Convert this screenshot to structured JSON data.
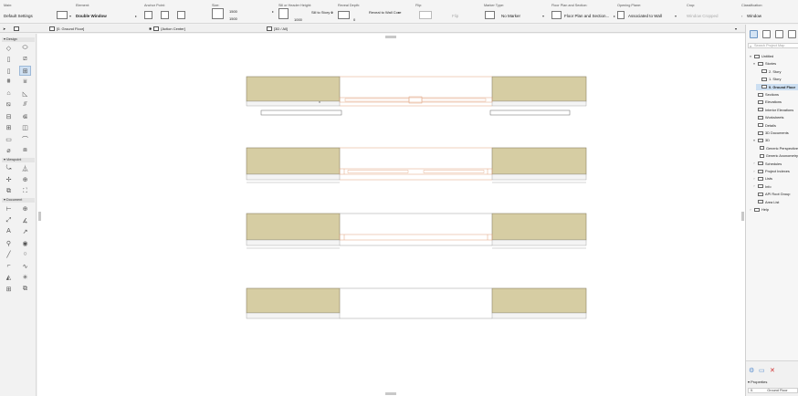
{
  "infobar": {
    "main": {
      "title": "Main:",
      "value": "Default Settings"
    },
    "element": {
      "title": "Element:",
      "value": "Double Window"
    },
    "anchor": {
      "title": "Anchor Point:"
    },
    "size": {
      "title": "Size:",
      "width": "1500",
      "height": "1500"
    },
    "sill": {
      "title": "Sill or Header Height:",
      "value": "1000",
      "mode": "Sill to Story 0"
    },
    "reveal": {
      "title": "Reveal Depth:",
      "value": "0",
      "mode": "Reveal to Wall Core"
    },
    "flip": {
      "title": "Flip:",
      "value": "Flip"
    },
    "marker": {
      "title": "Marker Type:",
      "value": "No Marker"
    },
    "floorplan": {
      "title": "Floor Plan and Section:",
      "value": "Floor Plan and Section..."
    },
    "opening": {
      "title": "Opening Plane:",
      "value": "Associated to Wall"
    },
    "crop": {
      "title": "Crop:",
      "value": "Window Cropped"
    },
    "classification": {
      "title": "Classification:",
      "value": "Window"
    }
  },
  "tabs": [
    {
      "label": "[0. Ground Floor]"
    },
    {
      "label": "[Action Center]"
    },
    {
      "label": "[3D / All]"
    }
  ],
  "toolbox": {
    "sections": [
      "Design",
      "Viewpoint",
      "Document"
    ]
  },
  "navigator": {
    "search_placeholder": "Search Project Map",
    "tree": [
      {
        "label": "Untitled",
        "level": 0,
        "toggle": "▾"
      },
      {
        "label": "Stories",
        "level": 1,
        "toggle": "▾"
      },
      {
        "label": "2. Story",
        "level": 2,
        "toggle": ""
      },
      {
        "label": "1. Story",
        "level": 2,
        "toggle": ""
      },
      {
        "label": "0. Ground Floor",
        "level": 2,
        "toggle": "",
        "selected": true
      },
      {
        "label": "Sections",
        "level": 1,
        "toggle": ""
      },
      {
        "label": "Elevations",
        "level": 1,
        "toggle": ""
      },
      {
        "label": "Interior Elevations",
        "level": 1,
        "toggle": ""
      },
      {
        "label": "Worksheets",
        "level": 1,
        "toggle": ""
      },
      {
        "label": "Details",
        "level": 1,
        "toggle": ""
      },
      {
        "label": "3D Documents",
        "level": 1,
        "toggle": ""
      },
      {
        "label": "3D",
        "level": 1,
        "toggle": "▾"
      },
      {
        "label": "Generic Perspective",
        "level": 2,
        "toggle": ""
      },
      {
        "label": "Generic Axonometry",
        "level": 2,
        "toggle": ""
      },
      {
        "label": "Schedules",
        "level": 1,
        "toggle": "›"
      },
      {
        "label": "Project Indexes",
        "level": 1,
        "toggle": "›"
      },
      {
        "label": "Lists",
        "level": 1,
        "toggle": "›"
      },
      {
        "label": "Info",
        "level": 1,
        "toggle": "›"
      },
      {
        "label": "API Root Group",
        "level": 1,
        "toggle": ""
      },
      {
        "label": "Area List",
        "level": 1,
        "toggle": ""
      },
      {
        "label": "Help",
        "level": 0,
        "toggle": "›"
      }
    ],
    "properties_title": "Properties",
    "properties_row": {
      "id": "0.",
      "value": "Ground Floor"
    }
  },
  "colors": {
    "wall_fill": "#d6cda3",
    "wall_stroke": "#8a8266",
    "window_stroke": "#e0a07c",
    "selection": "#ccdff2"
  }
}
